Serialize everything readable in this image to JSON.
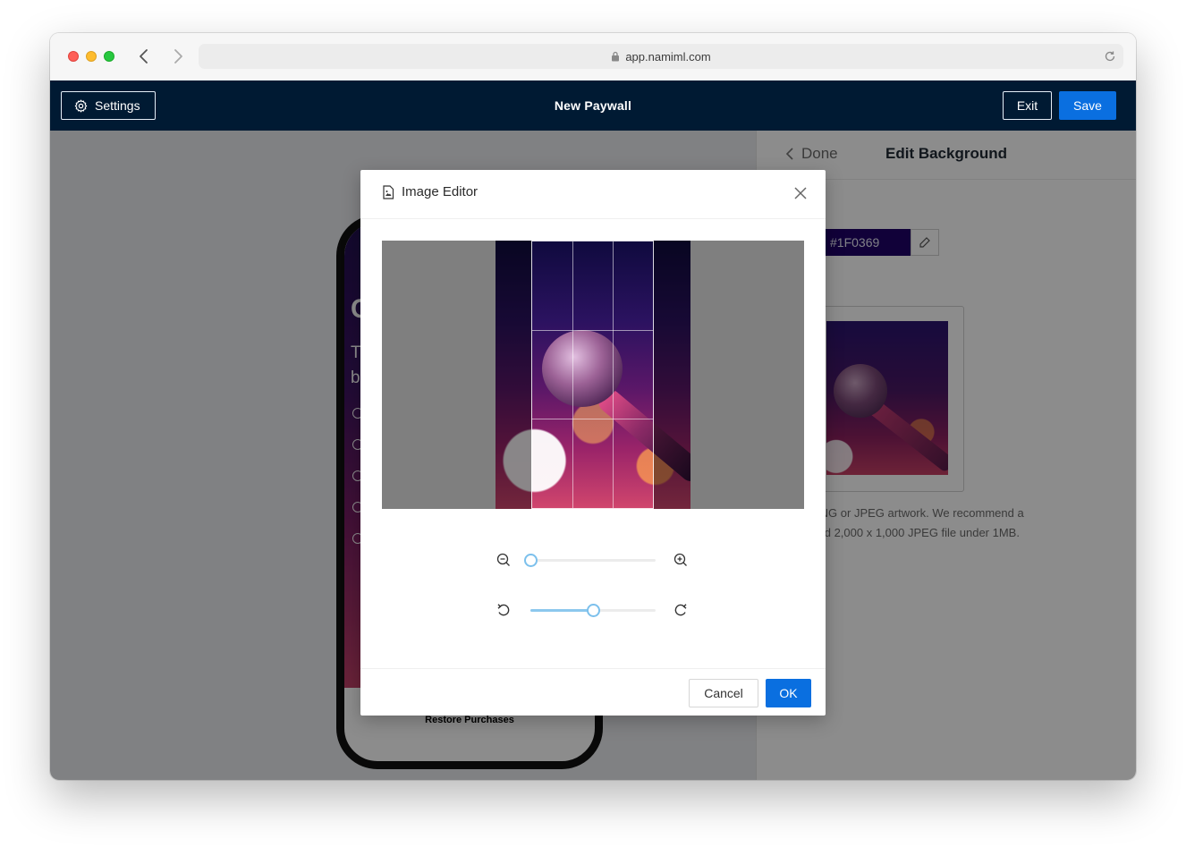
{
  "browser": {
    "url": "app.namiml.com"
  },
  "header": {
    "settings_label": "Settings",
    "title": "New Paywall",
    "exit_label": "Exit",
    "save_label": "Save"
  },
  "preview": {
    "headline_fragment": "C",
    "body_fragment_1": "T",
    "body_fragment_2": "b",
    "restore_label": "Restore Purchases"
  },
  "panel": {
    "back_label": "Done",
    "title": "Edit Background",
    "color_value": "#1F0369",
    "help_line_1": "PNG or JPEG artwork. We recommend a",
    "help_line_2": "sed 2,000 x 1,000 JPEG file under 1MB."
  },
  "modal": {
    "title": "Image Editor",
    "zoom": {
      "value": 0.0,
      "out_icon": "zoom-out-icon",
      "in_icon": "zoom-in-icon"
    },
    "rotate": {
      "value": 0.5,
      "left_icon": "rotate-left-icon",
      "right_icon": "rotate-right-icon"
    },
    "cancel_label": "Cancel",
    "ok_label": "OK"
  },
  "colors": {
    "app_header": "#001a33",
    "primary": "#0a6fe0",
    "background_color": "#1f0369"
  }
}
